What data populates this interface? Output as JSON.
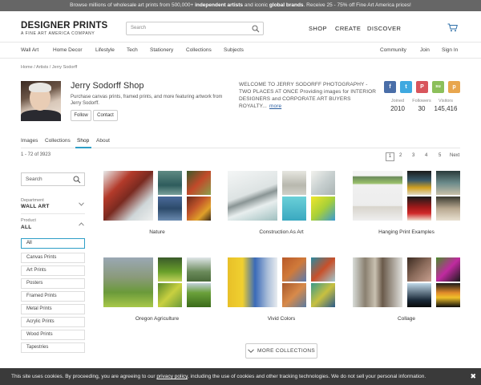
{
  "promo": {
    "prefix": "Browse millions of wholesale art prints from 500,000+ ",
    "bold1": "independent artists",
    "mid": " and iconic ",
    "bold2": "global brands",
    "suffix": ". Receive 25 - 75% off Fine Art America prices!"
  },
  "logo": {
    "main": "DESIGNER PRINTS",
    "sub": "A FINE ART AMERICA COMPANY"
  },
  "search": {
    "placeholder": "Search"
  },
  "topnav": [
    "SHOP",
    "CREATE",
    "DISCOVER"
  ],
  "catnav_left": [
    "Wall Art",
    "Home Decor",
    "Lifestyle",
    "Tech",
    "Stationery",
    "Collections",
    "Subjects"
  ],
  "catnav_right": [
    "Community",
    "Join",
    "Sign In"
  ],
  "breadcrumb": "Home / Artists / Jerry Sodorff",
  "profile": {
    "name": "Jerry Sodorff Shop",
    "description": "Purchase canvas prints, framed prints, and more featuring artwork from Jerry Sodorff.",
    "follow": "Follow",
    "contact": "Contact",
    "welcome": "WELCOME TO JERRY SODORFF PHOTOGRAPHY - TWO PLACES AT ONCE Providing images for INTERIOR DESIGNERS and CORPORATE ART BUYERS ROYALTY...",
    "more": "more"
  },
  "social": [
    {
      "glyph": "f",
      "color": "#4a6ea8"
    },
    {
      "glyph": "t",
      "color": "#3fa9e0"
    },
    {
      "glyph": "P",
      "color": "#d8555c"
    },
    {
      "glyph": "su",
      "color": "#8cbf5a"
    },
    {
      "glyph": "p",
      "color": "#e8a64e"
    }
  ],
  "stats": [
    {
      "label": "Joined",
      "value": "2010"
    },
    {
      "label": "Followers",
      "value": "30"
    },
    {
      "label": "Visitors",
      "value": "145,416"
    }
  ],
  "tabs": [
    "Images",
    "Collections",
    "Shop",
    "About"
  ],
  "results": {
    "count": "1 - 72 of 3923"
  },
  "pagination": [
    "1",
    "2",
    "3",
    "4",
    "5",
    "Next"
  ],
  "sidebar": {
    "search_placeholder": "Search",
    "department_label": "Department",
    "department_value": "WALL ART",
    "product_label": "Product",
    "product_value": "ALL",
    "options": [
      "All",
      "Canvas Prints",
      "Art Prints",
      "Posters",
      "Framed Prints",
      "Metal Prints",
      "Acrylic Prints",
      "Wood Prints",
      "Tapestries"
    ]
  },
  "collections": [
    {
      "title": "Nature"
    },
    {
      "title": "Construction As Art"
    },
    {
      "title": "Hanging Print Examples"
    },
    {
      "title": "Oregon Agriculture"
    },
    {
      "title": "Vivid Colors"
    },
    {
      "title": "Collage"
    }
  ],
  "more_button": "MORE COLLECTIONS",
  "cookie": {
    "prefix": "This site uses cookies.  By proceeding, you are agreeing to our ",
    "link": "privacy policy",
    "suffix": ", including the use of cookies and other tracking technologies.   We do not sell your personal information.",
    "close": "✖"
  }
}
